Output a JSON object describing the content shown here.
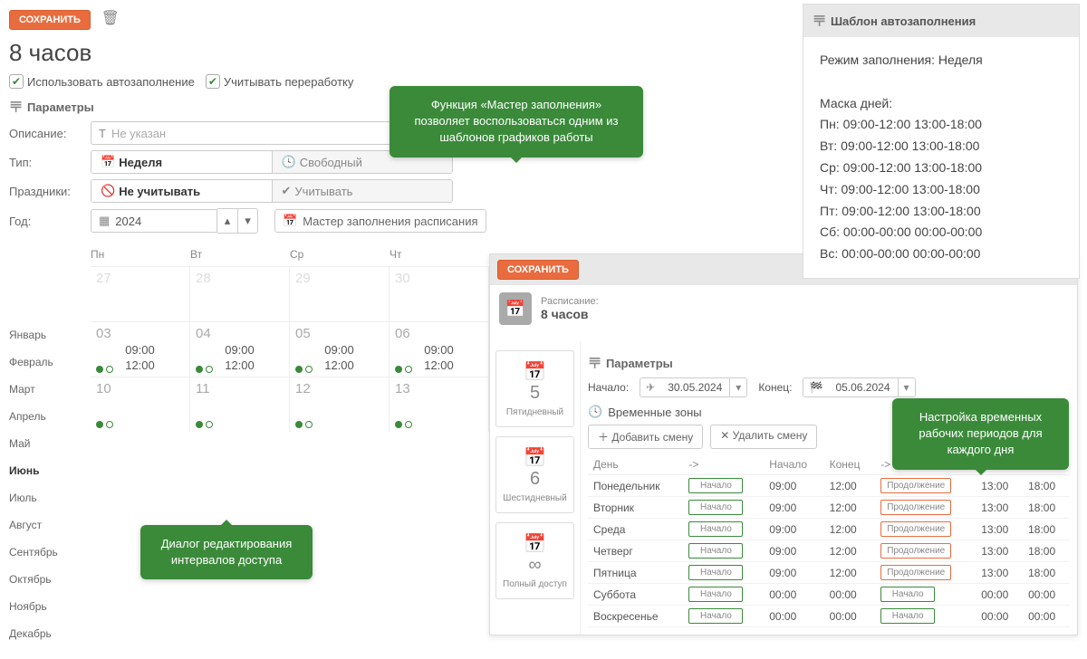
{
  "save_label": "СОХРАНИТЬ",
  "title": "8 часов",
  "use_autofill_label": "Использовать автозаполнение",
  "account_overtime_label": "Учитывать переработку",
  "params_label": "Параметры",
  "desc_label": "Описание:",
  "desc_placeholder": "Не указан",
  "type_label": "Тип:",
  "type_week": "Неделя",
  "type_free": "Свободный",
  "holidays_label": "Праздники:",
  "holidays_ignore": "Не учитывать",
  "holidays_account": "Учитывать",
  "year_label": "Год:",
  "year_value": "2024",
  "wizard_label": "Мастер заполнения расписания",
  "months": [
    "Январь",
    "Февраль",
    "Март",
    "Апрель",
    "Май",
    "Июнь",
    "Июль",
    "Август",
    "Сентябрь",
    "Октябрь",
    "Ноябрь",
    "Декабрь"
  ],
  "current_month_index": 5,
  "dow": [
    "Пн",
    "Вт",
    "Ср",
    "Чт"
  ],
  "cal_rows": [
    {
      "nums": [
        "27",
        "28",
        "29",
        "30"
      ],
      "dim": true,
      "times": false,
      "dots": false
    },
    {
      "nums": [
        "03",
        "04",
        "05",
        "06"
      ],
      "dim": false,
      "times": true,
      "t1": "09:00",
      "t2": "12:00",
      "dots": true
    },
    {
      "nums": [
        "10",
        "11",
        "12",
        "13"
      ],
      "dim": false,
      "times": false,
      "dots": true
    }
  ],
  "callout1": "Функция «Мастер заполнения» позволяет воспользоваться одним из шаблонов графиков работы",
  "callout2": "Диалог редактирования интервалов доступа",
  "callout3": "Настройка временных рабочих периодов для каждого дня",
  "wizard": {
    "schedule_small": "Расписание:",
    "schedule_name": "8 часов",
    "presets": [
      "Пятидневный",
      "Шестидневный",
      "Полный доступ"
    ],
    "start_label": "Начало:",
    "start_date": "30.05.2024",
    "end_label": "Конец:",
    "end_date": "05.06.2024",
    "tz_label": "Временные зоны",
    "add_shift": "Добавить смену",
    "del_shift": "Удалить смену",
    "th_day": "День",
    "th_arrow": "->",
    "th_start": "Начало",
    "th_end": "Конец",
    "tag_start": "Начало",
    "tag_cont": "Продолжение",
    "rows": [
      {
        "day": "Понедельник",
        "t1s": "09:00",
        "t1e": "12:00",
        "t2s": "13:00",
        "t2e": "18:00",
        "cont": true
      },
      {
        "day": "Вторник",
        "t1s": "09:00",
        "t1e": "12:00",
        "t2s": "13:00",
        "t2e": "18:00",
        "cont": true
      },
      {
        "day": "Среда",
        "t1s": "09:00",
        "t1e": "12:00",
        "t2s": "13:00",
        "t2e": "18:00",
        "cont": true
      },
      {
        "day": "Четверг",
        "t1s": "09:00",
        "t1e": "12:00",
        "t2s": "13:00",
        "t2e": "18:00",
        "cont": true
      },
      {
        "day": "Пятница",
        "t1s": "09:00",
        "t1e": "12:00",
        "t2s": "13:00",
        "t2e": "18:00",
        "cont": true
      },
      {
        "day": "Суббота",
        "t1s": "00:00",
        "t1e": "00:00",
        "t2s": "00:00",
        "t2e": "00:00",
        "cont": false
      },
      {
        "day": "Воскресенье",
        "t1s": "00:00",
        "t1e": "00:00",
        "t2s": "00:00",
        "t2e": "00:00",
        "cont": false
      }
    ]
  },
  "autofill": {
    "title": "Шаблон автозаполнения",
    "mode": "Режим заполнения: Неделя",
    "mask_label": "Маска дней:",
    "lines": [
      "Пн: 09:00-12:00 13:00-18:00",
      "Вт: 09:00-12:00 13:00-18:00",
      "Ср: 09:00-12:00 13:00-18:00",
      "Чт: 09:00-12:00 13:00-18:00",
      "Пт: 09:00-12:00 13:00-18:00",
      "Сб: 00:00-00:00 00:00-00:00",
      "Вс: 00:00-00:00 00:00-00:00"
    ]
  }
}
